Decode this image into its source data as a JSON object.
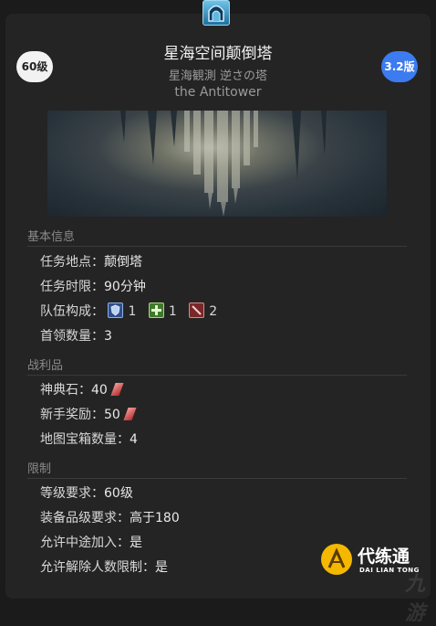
{
  "duty": {
    "level_badge": "60级",
    "version_badge": "3.2版",
    "name_zh": "星海空间颠倒塔",
    "name_ja": "星海観測 逆さの塔",
    "name_en": "the Antitower"
  },
  "sections": {
    "basic_title": "基本信息",
    "loot_title": "战利品",
    "restrict_title": "限制"
  },
  "basic": {
    "location_label": "任务地点：",
    "location_value": "颠倒塔",
    "time_label": "任务时限：",
    "time_value": "90分钟",
    "party_label": "队伍构成：",
    "party": [
      {
        "role": "tank-icon",
        "count": "1"
      },
      {
        "role": "healer-icon",
        "count": "1"
      },
      {
        "role": "dps-icon",
        "count": "2"
      }
    ],
    "boss_label": "首领数量：",
    "boss_value": "3"
  },
  "loot": {
    "tomestone_label": "神典石：",
    "tomestone_value": "40",
    "rookie_label": "新手奖励：",
    "rookie_value": "50",
    "chest_label": "地图宝箱数量：",
    "chest_value": "4"
  },
  "restrict": {
    "level_label": "等级要求：",
    "level_value": "60级",
    "ilvl_label": "装备品级要求：",
    "ilvl_value": "高于180",
    "join_label": "允许中途加入：",
    "join_value": "是",
    "unsync_label": "允许解除人数限制：",
    "unsync_value": "是"
  },
  "watermark": {
    "main": "代练通",
    "sub": "DAI LIAN TONG",
    "faint": "九游"
  },
  "colors": {
    "version_badge": "#3c7bf0",
    "logo_accent": "#f5b800"
  }
}
